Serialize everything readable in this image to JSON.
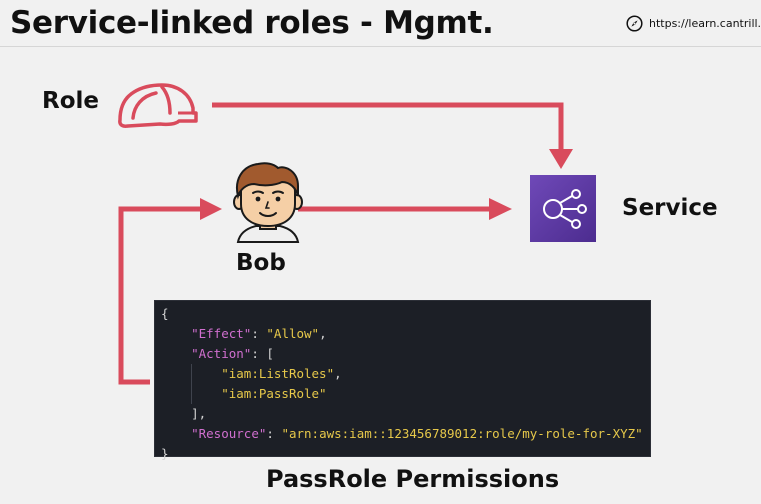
{
  "slide": {
    "title": "Service-linked roles - Mgmt.",
    "site_url": "https://learn.cantrill.io",
    "site_icon": "compass-icon"
  },
  "diagram": {
    "role_label": "Role",
    "role_icon": "hardhat-icon",
    "bob_label": "Bob",
    "bob_icon": "person-avatar-icon",
    "service_label": "Service",
    "service_icon": "service-nodes-icon",
    "caption": "PassRole Permissions",
    "arrow_color": "#d94b5c",
    "service_color": "#5a35a0"
  },
  "policy": {
    "open_brace": "{",
    "effect_key": "\"Effect\"",
    "effect_value": "\"Allow\"",
    "action_key": "\"Action\"",
    "action_open": "[",
    "action_1": "\"iam:ListRoles\"",
    "action_2": "\"iam:PassRole\"",
    "action_close": "],",
    "resource_key": "\"Resource\"",
    "resource_value": "\"arn:aws:iam::123456789012:role/my-role-for-XYZ\"",
    "close_brace": "}"
  }
}
